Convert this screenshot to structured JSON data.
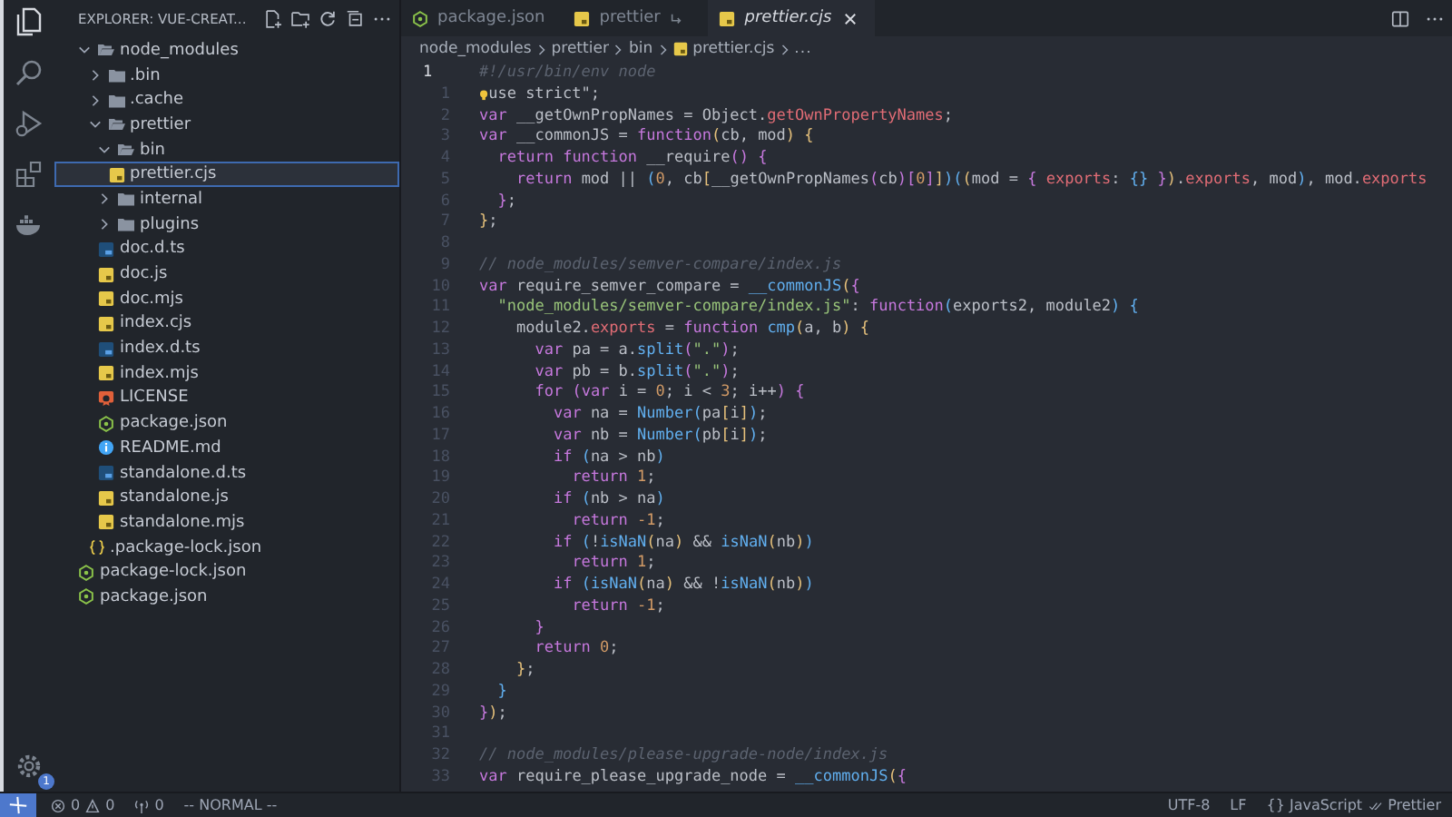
{
  "activity_bar": {
    "badge": "1"
  },
  "sidebar": {
    "title": "EXPLORER: VUE-CREAT...",
    "tree": [
      {
        "name": "node_modules",
        "kind": "folder",
        "expanded": true,
        "selected": false,
        "children": [
          {
            "name": ".bin",
            "kind": "folder",
            "expanded": false,
            "selected": false
          },
          {
            "name": ".cache",
            "kind": "folder",
            "expanded": false,
            "selected": false
          },
          {
            "name": "prettier",
            "kind": "folder",
            "expanded": true,
            "selected": false,
            "children": [
              {
                "name": "bin",
                "kind": "folder",
                "expanded": true,
                "selected": false,
                "children": [
                  {
                    "name": "prettier.cjs",
                    "kind": "js",
                    "selected": true
                  }
                ]
              },
              {
                "name": "internal",
                "kind": "folder",
                "expanded": false,
                "selected": false
              },
              {
                "name": "plugins",
                "kind": "folder",
                "expanded": false,
                "selected": false
              },
              {
                "name": "doc.d.ts",
                "kind": "ts",
                "selected": false
              },
              {
                "name": "doc.js",
                "kind": "js",
                "selected": false
              },
              {
                "name": "doc.mjs",
                "kind": "js",
                "selected": false
              },
              {
                "name": "index.cjs",
                "kind": "js",
                "selected": false
              },
              {
                "name": "index.d.ts",
                "kind": "ts",
                "selected": false
              },
              {
                "name": "index.mjs",
                "kind": "js",
                "selected": false
              },
              {
                "name": "LICENSE",
                "kind": "license",
                "selected": false
              },
              {
                "name": "package.json",
                "kind": "npm",
                "selected": false
              },
              {
                "name": "README.md",
                "kind": "readme",
                "selected": false
              },
              {
                "name": "standalone.d.ts",
                "kind": "ts",
                "selected": false
              },
              {
                "name": "standalone.js",
                "kind": "js",
                "selected": false
              },
              {
                "name": "standalone.mjs",
                "kind": "js",
                "selected": false
              }
            ]
          },
          {
            "name": ".package-lock.json",
            "kind": "json",
            "selected": false
          }
        ]
      },
      {
        "name": "package-lock.json",
        "kind": "npm",
        "selected": false
      },
      {
        "name": "package.json",
        "kind": "npm",
        "selected": false
      }
    ]
  },
  "tabs": [
    {
      "label": "package.json",
      "kind": "npm",
      "selected": false,
      "preview": false,
      "symlink": false
    },
    {
      "label": "prettier",
      "kind": "js",
      "selected": false,
      "preview": false,
      "symlink": true
    },
    {
      "label": "prettier.cjs",
      "kind": "js",
      "selected": true,
      "preview": true,
      "symlink": false
    }
  ],
  "breadcrumbs": [
    {
      "text": "node_modules",
      "kind": "folder"
    },
    {
      "text": "prettier",
      "kind": "folder"
    },
    {
      "text": "bin",
      "kind": "folder"
    },
    {
      "text": "prettier.cjs",
      "kind": "js"
    },
    {
      "text": "...",
      "kind": "more"
    }
  ],
  "code_lines": [
    {
      "number": "1",
      "current": true,
      "tokens": [
        {
          "kind": "com",
          "text": "#!/usr/bin/env node"
        }
      ]
    },
    {
      "number": "1",
      "current": false,
      "tokens": [
        {
          "kind": "bulb"
        },
        {
          "kind": "plain",
          "text": "use strict\";"
        }
      ]
    },
    {
      "number": "2",
      "current": false,
      "tokens": [
        {
          "kind": "kw",
          "text": "var "
        },
        {
          "kind": "plain",
          "text": "__getOwnPropNames = Object."
        },
        {
          "kind": "prop",
          "text": "getOwnPropertyNames"
        },
        {
          "kind": "plain",
          "text": ";"
        }
      ]
    },
    {
      "number": "3",
      "current": false,
      "tokens": [
        {
          "kind": "kw",
          "text": "var "
        },
        {
          "kind": "plain",
          "text": "__commonJS = "
        },
        {
          "kind": "kw",
          "text": "function"
        },
        {
          "kind": "br1",
          "text": "("
        },
        {
          "kind": "plain",
          "text": "cb, mod"
        },
        {
          "kind": "br1",
          "text": ")"
        },
        {
          "kind": "br1",
          "text": " {"
        }
      ]
    },
    {
      "number": "4",
      "current": false,
      "tokens": [
        {
          "kind": "kw",
          "text": "  return function "
        },
        {
          "kind": "plain",
          "text": "__require"
        },
        {
          "kind": "br2",
          "text": "()"
        },
        {
          "kind": "br2",
          "text": " {"
        }
      ]
    },
    {
      "number": "5",
      "current": false,
      "tokens": [
        {
          "kind": "kw",
          "text": "    return "
        },
        {
          "kind": "plain",
          "text": "mod || "
        },
        {
          "kind": "br3",
          "text": "("
        },
        {
          "kind": "num",
          "text": "0"
        },
        {
          "kind": "plain",
          "text": ", cb"
        },
        {
          "kind": "br1",
          "text": "["
        },
        {
          "kind": "plain",
          "text": "__getOwnPropNames"
        },
        {
          "kind": "br2",
          "text": "("
        },
        {
          "kind": "plain",
          "text": "cb"
        },
        {
          "kind": "br2",
          "text": ")["
        },
        {
          "kind": "num",
          "text": "0"
        },
        {
          "kind": "br2",
          "text": "]"
        },
        {
          "kind": "br1",
          "text": "]"
        },
        {
          "kind": "br3",
          "text": ")("
        },
        {
          "kind": "br1",
          "text": "("
        },
        {
          "kind": "plain",
          "text": "mod = "
        },
        {
          "kind": "br2",
          "text": "{"
        },
        {
          "kind": "prop",
          "text": " exports"
        },
        {
          "kind": "plain",
          "text": ": "
        },
        {
          "kind": "br3",
          "text": "{}"
        },
        {
          "kind": "br2",
          "text": " }"
        },
        {
          "kind": "br1",
          "text": ")"
        },
        {
          "kind": "plain",
          "text": "."
        },
        {
          "kind": "prop",
          "text": "exports"
        },
        {
          "kind": "plain",
          "text": ", mod"
        },
        {
          "kind": "br3",
          "text": ")"
        },
        {
          "kind": "plain",
          "text": ", mod."
        },
        {
          "kind": "prop",
          "text": "exports"
        }
      ]
    },
    {
      "number": "6",
      "current": false,
      "tokens": [
        {
          "kind": "br2",
          "text": "  }"
        },
        {
          "kind": "plain",
          "text": ";"
        }
      ]
    },
    {
      "number": "7",
      "current": false,
      "tokens": [
        {
          "kind": "br1",
          "text": "}"
        },
        {
          "kind": "plain",
          "text": ";"
        }
      ]
    },
    {
      "number": "8",
      "current": false
    },
    {
      "number": "9",
      "current": false,
      "tokens": [
        {
          "kind": "com",
          "text": "// node_modules/semver-compare/index.js"
        }
      ]
    },
    {
      "number": "10",
      "current": false,
      "tokens": [
        {
          "kind": "kw",
          "text": "var "
        },
        {
          "kind": "plain",
          "text": "require_semver_compare = "
        },
        {
          "kind": "fn",
          "text": "__commonJS"
        },
        {
          "kind": "br1",
          "text": "("
        },
        {
          "kind": "br2",
          "text": "{"
        }
      ]
    },
    {
      "number": "11",
      "current": false,
      "tokens": [
        {
          "kind": "str",
          "text": "  \"node_modules/semver-compare/index.js\""
        },
        {
          "kind": "plain",
          "text": ": "
        },
        {
          "kind": "kw",
          "text": "function"
        },
        {
          "kind": "br3",
          "text": "("
        },
        {
          "kind": "plain",
          "text": "exports2, module2"
        },
        {
          "kind": "br3",
          "text": ")"
        },
        {
          "kind": "br3",
          "text": " {"
        }
      ]
    },
    {
      "number": "12",
      "current": false,
      "tokens": [
        {
          "kind": "plain",
          "text": "    module2."
        },
        {
          "kind": "prop",
          "text": "exports"
        },
        {
          "kind": "plain",
          "text": " = "
        },
        {
          "kind": "kw",
          "text": "function "
        },
        {
          "kind": "fn",
          "text": "cmp"
        },
        {
          "kind": "br1",
          "text": "("
        },
        {
          "kind": "plain",
          "text": "a, b"
        },
        {
          "kind": "br1",
          "text": ")"
        },
        {
          "kind": "br1",
          "text": " {"
        }
      ]
    },
    {
      "number": "13",
      "current": false,
      "tokens": [
        {
          "kind": "kw",
          "text": "      var "
        },
        {
          "kind": "plain",
          "text": "pa = a."
        },
        {
          "kind": "fn",
          "text": "split"
        },
        {
          "kind": "br2",
          "text": "("
        },
        {
          "kind": "str",
          "text": "\".\""
        },
        {
          "kind": "br2",
          "text": ")"
        },
        {
          "kind": "plain",
          "text": ";"
        }
      ]
    },
    {
      "number": "14",
      "current": false,
      "tokens": [
        {
          "kind": "kw",
          "text": "      var "
        },
        {
          "kind": "plain",
          "text": "pb = b."
        },
        {
          "kind": "fn",
          "text": "split"
        },
        {
          "kind": "br2",
          "text": "("
        },
        {
          "kind": "str",
          "text": "\".\""
        },
        {
          "kind": "br2",
          "text": ")"
        },
        {
          "kind": "plain",
          "text": ";"
        }
      ]
    },
    {
      "number": "15",
      "current": false,
      "tokens": [
        {
          "kind": "kw",
          "text": "      for "
        },
        {
          "kind": "br2",
          "text": "("
        },
        {
          "kind": "kw",
          "text": "var "
        },
        {
          "kind": "plain",
          "text": "i = "
        },
        {
          "kind": "num",
          "text": "0"
        },
        {
          "kind": "plain",
          "text": "; i < "
        },
        {
          "kind": "num",
          "text": "3"
        },
        {
          "kind": "plain",
          "text": "; i++"
        },
        {
          "kind": "br2",
          "text": ")"
        },
        {
          "kind": "br2",
          "text": " {"
        }
      ]
    },
    {
      "number": "16",
      "current": false,
      "tokens": [
        {
          "kind": "kw",
          "text": "        var "
        },
        {
          "kind": "plain",
          "text": "na = "
        },
        {
          "kind": "fn",
          "text": "Number"
        },
        {
          "kind": "br3",
          "text": "("
        },
        {
          "kind": "plain",
          "text": "pa"
        },
        {
          "kind": "br1",
          "text": "["
        },
        {
          "kind": "plain",
          "text": "i"
        },
        {
          "kind": "br1",
          "text": "]"
        },
        {
          "kind": "br3",
          "text": ")"
        },
        {
          "kind": "plain",
          "text": ";"
        }
      ]
    },
    {
      "number": "17",
      "current": false,
      "tokens": [
        {
          "kind": "kw",
          "text": "        var "
        },
        {
          "kind": "plain",
          "text": "nb = "
        },
        {
          "kind": "fn",
          "text": "Number"
        },
        {
          "kind": "br3",
          "text": "("
        },
        {
          "kind": "plain",
          "text": "pb"
        },
        {
          "kind": "br1",
          "text": "["
        },
        {
          "kind": "plain",
          "text": "i"
        },
        {
          "kind": "br1",
          "text": "]"
        },
        {
          "kind": "br3",
          "text": ")"
        },
        {
          "kind": "plain",
          "text": ";"
        }
      ]
    },
    {
      "number": "18",
      "current": false,
      "tokens": [
        {
          "kind": "kw",
          "text": "        if "
        },
        {
          "kind": "br3",
          "text": "("
        },
        {
          "kind": "plain",
          "text": "na > nb"
        },
        {
          "kind": "br3",
          "text": ")"
        }
      ]
    },
    {
      "number": "19",
      "current": false,
      "tokens": [
        {
          "kind": "kw",
          "text": "          return "
        },
        {
          "kind": "num",
          "text": "1"
        },
        {
          "kind": "plain",
          "text": ";"
        }
      ]
    },
    {
      "number": "20",
      "current": false,
      "tokens": [
        {
          "kind": "kw",
          "text": "        if "
        },
        {
          "kind": "br3",
          "text": "("
        },
        {
          "kind": "plain",
          "text": "nb > na"
        },
        {
          "kind": "br3",
          "text": ")"
        }
      ]
    },
    {
      "number": "21",
      "current": false,
      "tokens": [
        {
          "kind": "kw",
          "text": "          return "
        },
        {
          "kind": "num",
          "text": "-1"
        },
        {
          "kind": "plain",
          "text": ";"
        }
      ]
    },
    {
      "number": "22",
      "current": false,
      "tokens": [
        {
          "kind": "kw",
          "text": "        if "
        },
        {
          "kind": "br3",
          "text": "("
        },
        {
          "kind": "plain",
          "text": "!"
        },
        {
          "kind": "fn",
          "text": "isNaN"
        },
        {
          "kind": "br1",
          "text": "("
        },
        {
          "kind": "plain",
          "text": "na"
        },
        {
          "kind": "br1",
          "text": ")"
        },
        {
          "kind": "plain",
          "text": " && "
        },
        {
          "kind": "fn",
          "text": "isNaN"
        },
        {
          "kind": "br1",
          "text": "("
        },
        {
          "kind": "plain",
          "text": "nb"
        },
        {
          "kind": "br1",
          "text": ")"
        },
        {
          "kind": "br3",
          "text": ")"
        }
      ]
    },
    {
      "number": "23",
      "current": false,
      "tokens": [
        {
          "kind": "kw",
          "text": "          return "
        },
        {
          "kind": "num",
          "text": "1"
        },
        {
          "kind": "plain",
          "text": ";"
        }
      ]
    },
    {
      "number": "24",
      "current": false,
      "tokens": [
        {
          "kind": "kw",
          "text": "        if "
        },
        {
          "kind": "br3",
          "text": "("
        },
        {
          "kind": "fn",
          "text": "isNaN"
        },
        {
          "kind": "br1",
          "text": "("
        },
        {
          "kind": "plain",
          "text": "na"
        },
        {
          "kind": "br1",
          "text": ")"
        },
        {
          "kind": "plain",
          "text": " && !"
        },
        {
          "kind": "fn",
          "text": "isNaN"
        },
        {
          "kind": "br1",
          "text": "("
        },
        {
          "kind": "plain",
          "text": "nb"
        },
        {
          "kind": "br1",
          "text": ")"
        },
        {
          "kind": "br3",
          "text": ")"
        }
      ]
    },
    {
      "number": "25",
      "current": false,
      "tokens": [
        {
          "kind": "kw",
          "text": "          return "
        },
        {
          "kind": "num",
          "text": "-1"
        },
        {
          "kind": "plain",
          "text": ";"
        }
      ]
    },
    {
      "number": "26",
      "current": false,
      "tokens": [
        {
          "kind": "br2",
          "text": "      }"
        }
      ]
    },
    {
      "number": "27",
      "current": false,
      "tokens": [
        {
          "kind": "kw",
          "text": "      return "
        },
        {
          "kind": "num",
          "text": "0"
        },
        {
          "kind": "plain",
          "text": ";"
        }
      ]
    },
    {
      "number": "28",
      "current": false,
      "tokens": [
        {
          "kind": "br1",
          "text": "    }"
        },
        {
          "kind": "plain",
          "text": ";"
        }
      ]
    },
    {
      "number": "29",
      "current": false,
      "tokens": [
        {
          "kind": "br3",
          "text": "  }"
        }
      ]
    },
    {
      "number": "30",
      "current": false,
      "tokens": [
        {
          "kind": "br2",
          "text": "}"
        },
        {
          "kind": "br1",
          "text": ")"
        },
        {
          "kind": "plain",
          "text": ";"
        }
      ]
    },
    {
      "number": "31",
      "current": false
    },
    {
      "number": "32",
      "current": false,
      "tokens": [
        {
          "kind": "com",
          "text": "// node_modules/please-upgrade-node/index.js"
        }
      ]
    },
    {
      "number": "33",
      "current": false,
      "tokens": [
        {
          "kind": "kw",
          "text": "var "
        },
        {
          "kind": "plain",
          "text": "require_please_upgrade_node = "
        },
        {
          "kind": "fn",
          "text": "__commonJS"
        },
        {
          "kind": "br1",
          "text": "("
        },
        {
          "kind": "br2",
          "text": "{"
        }
      ]
    }
  ],
  "status_bar": {
    "errors": "0",
    "warnings": "0",
    "ports": "0",
    "mode": "-- NORMAL --",
    "encoding": "UTF-8",
    "eol": "LF",
    "language": "{} JavaScript",
    "formatter": "Prettier"
  }
}
